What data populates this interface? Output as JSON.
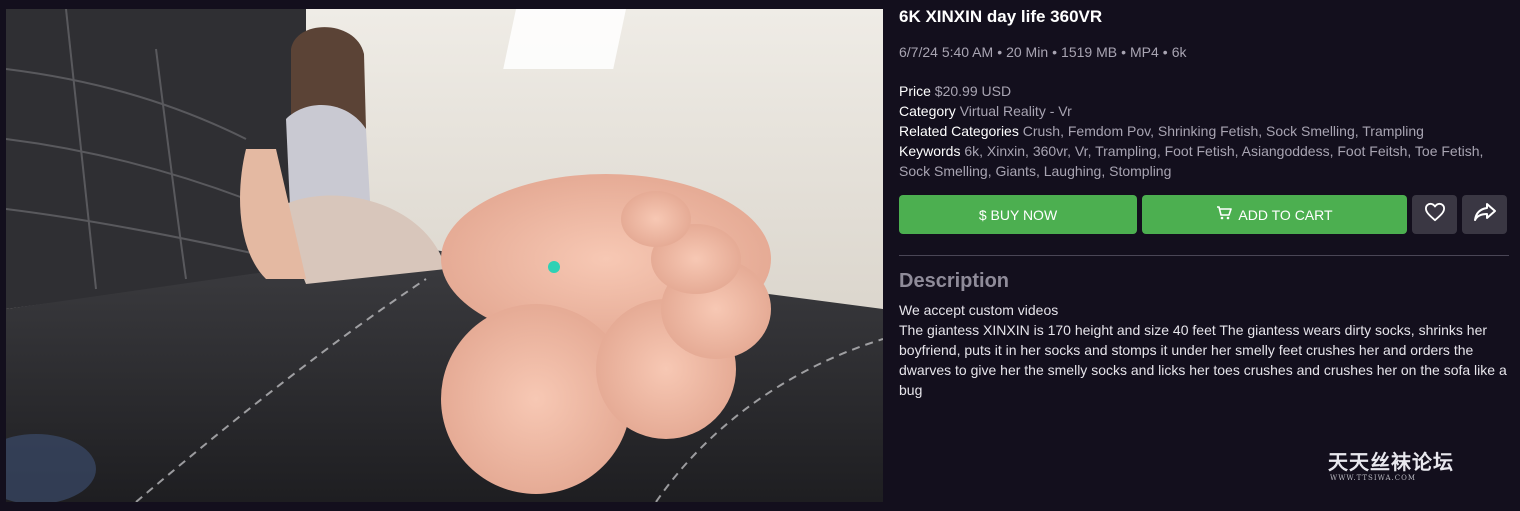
{
  "product": {
    "title": "6K XINXIN day life 360VR",
    "meta": {
      "date": "6/7/24 5:40 AM",
      "duration": "20 Min",
      "size": "1519 MB",
      "format": "MP4",
      "resolution": "6k",
      "separator": "•"
    },
    "price": {
      "label": "Price",
      "value": "$20.99 USD"
    },
    "category": {
      "label": "Category",
      "value": "Virtual Reality - Vr"
    },
    "related": {
      "label": "Related Categories",
      "value": "Crush, Femdom Pov, Shrinking Fetish, Sock Smelling, Trampling"
    },
    "keywords": {
      "label": "Keywords",
      "value": "6k, Xinxin, 360vr, Vr, Trampling, Foot Fetish, Asiangoddess, Foot Feitsh, Toe Fetish, Sock Smelling, Giants, Laughing, Stompling"
    }
  },
  "actions": {
    "buy_label": "$ BUY NOW",
    "cart_label": "ADD TO CART",
    "favorite_icon": "heart-icon",
    "share_icon": "share-icon",
    "cart_icon": "cart-icon",
    "accent": "#4caf50"
  },
  "description": {
    "heading": "Description",
    "line1": "We accept custom videos",
    "body": "The giantess XINXIN is 170 height and size 40 feet The giantess wears dirty socks, shrinks her boyfriend, puts it in her socks and stomps it under her smelly feet crushes her and orders the dwarves to give her the smelly socks and licks her toes crushes and crushes her on the sofa like a bug"
  },
  "watermark": {
    "text": "天天丝袜论坛",
    "url": "WWW.TTSIWA.COM"
  }
}
